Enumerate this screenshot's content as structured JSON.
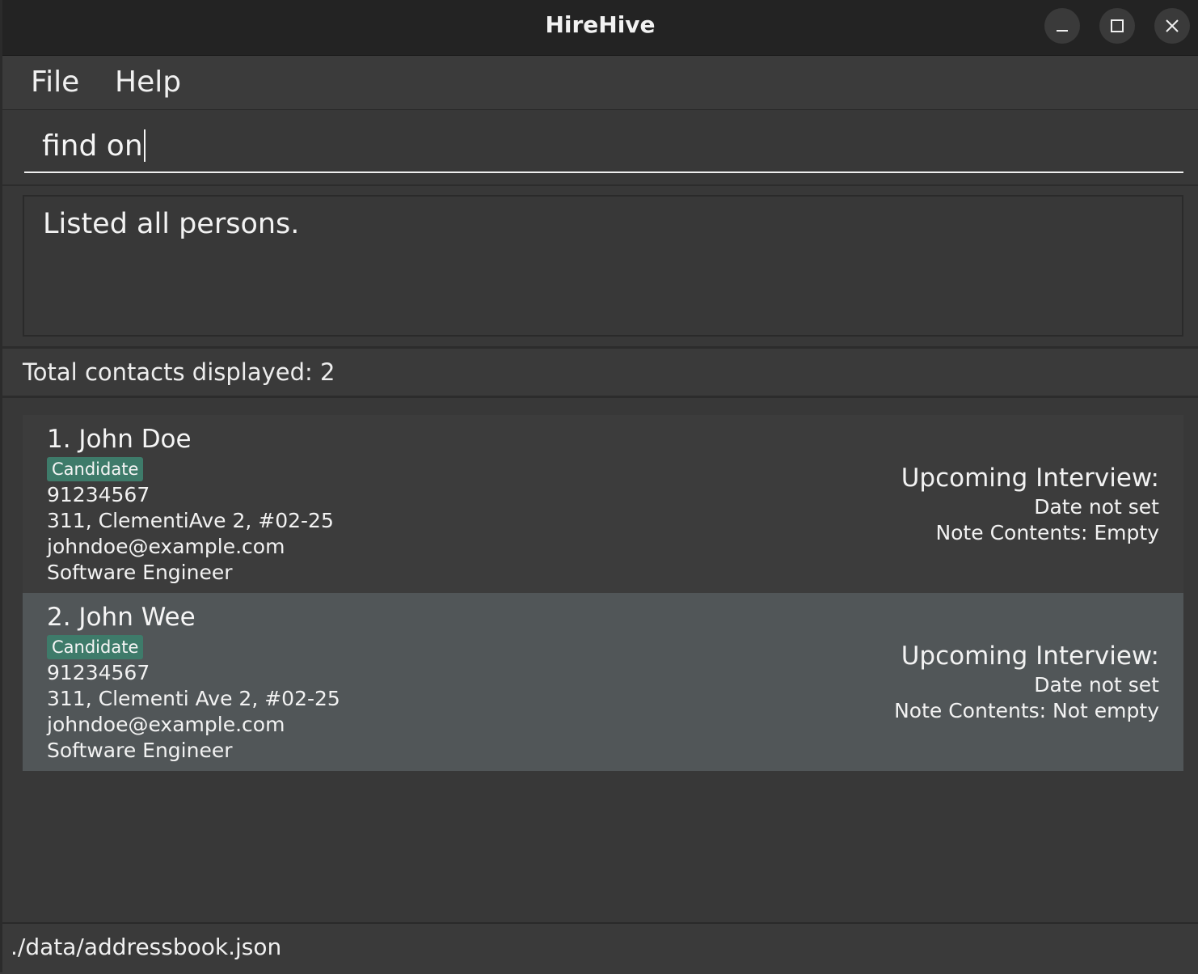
{
  "window": {
    "title": "HireHive"
  },
  "menu": {
    "items": [
      {
        "label": "File"
      },
      {
        "label": "Help"
      }
    ]
  },
  "command": {
    "value": "find on"
  },
  "result": {
    "message": "Listed all persons."
  },
  "list": {
    "count_label": "Total contacts displayed: 2",
    "contacts": [
      {
        "name": "1. John Doe",
        "tag": "Candidate",
        "phone": "91234567",
        "address": "311, ClementiAve 2, #02-25",
        "email": "johndoe@example.com",
        "role": "Software Engineer",
        "interview_heading": "Upcoming Interview:",
        "interview_date": "Date not set",
        "note": "Note Contents: Empty"
      },
      {
        "name": "2. John Wee",
        "tag": "Candidate",
        "phone": "91234567",
        "address": "311, Clementi Ave 2, #02-25",
        "email": "johndoe@example.com",
        "role": "Software Engineer",
        "interview_heading": "Upcoming Interview:",
        "interview_date": "Date not set",
        "note": "Note Contents: Not empty"
      }
    ]
  },
  "status": {
    "file_path": "./data/addressbook.json"
  },
  "colors": {
    "tag_background": "#3e7b6a",
    "selected_card": "#515658",
    "background": "#383838"
  }
}
